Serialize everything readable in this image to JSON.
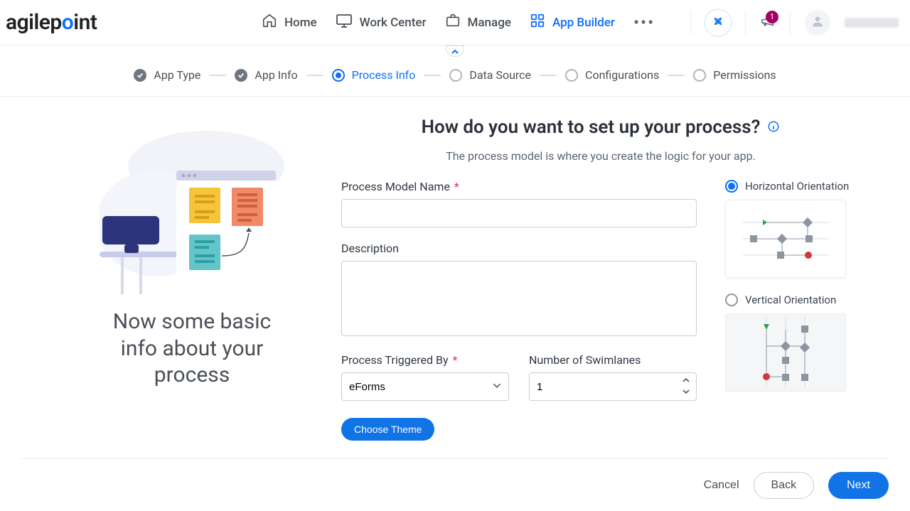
{
  "brand": {
    "name": "agilepoint"
  },
  "nav": {
    "home": "Home",
    "work_center": "Work Center",
    "manage": "Manage",
    "app_builder": "App Builder"
  },
  "notifications": {
    "count": "1"
  },
  "steps": {
    "app_type": "App Type",
    "app_info": "App Info",
    "process_info": "Process Info",
    "data_source": "Data Source",
    "configurations": "Configurations",
    "permissions": "Permissions"
  },
  "hero": {
    "caption": "Now some basic info about your process"
  },
  "page": {
    "title": "How do you want to set up your process?",
    "subtitle": "The process model is where you create the logic for your app."
  },
  "form": {
    "process_model_name_label": "Process Model Name",
    "process_model_name_value": "",
    "description_label": "Description",
    "description_value": "",
    "triggered_by_label": "Process Triggered By",
    "triggered_by_value": "eForms",
    "swimlanes_label": "Number of Swimlanes",
    "swimlanes_value": "1",
    "choose_theme_label": "Choose Theme"
  },
  "orientation": {
    "horizontal_label": "Horizontal Orientation",
    "vertical_label": "Vertical Orientation",
    "selected": "horizontal"
  },
  "footer": {
    "cancel": "Cancel",
    "back": "Back",
    "next": "Next"
  },
  "colors": {
    "primary": "#0d6efd",
    "text": "#333a44",
    "muted": "#6c757d"
  }
}
